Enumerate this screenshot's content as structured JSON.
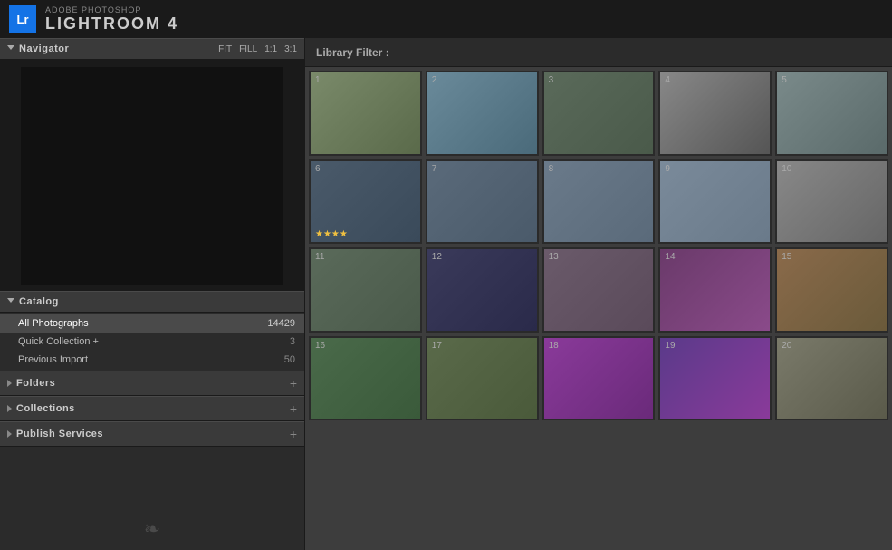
{
  "titlebar": {
    "adobe_label": "ADOBE PHOTOSHOP",
    "app_title": "LIGHTROOM 4",
    "logo_text": "Lr"
  },
  "navigator": {
    "label": "Navigator",
    "zoom_options": [
      "FIT",
      "FILL",
      "1:1",
      "3:1"
    ]
  },
  "catalog": {
    "label": "Catalog",
    "items": [
      {
        "name": "All Photographs",
        "count": "14429",
        "active": true
      },
      {
        "name": "Quick Collection +",
        "count": "3",
        "active": false
      },
      {
        "name": "Previous Import",
        "count": "50",
        "active": false
      }
    ]
  },
  "folders": {
    "label": "Folders",
    "add_icon": "+"
  },
  "collections": {
    "label": "Collections",
    "add_icon": "+"
  },
  "publish_services": {
    "label": "Publish Services",
    "add_icon": "+"
  },
  "filter_bar": {
    "label": "Library Filter :"
  },
  "grid": {
    "rows": [
      {
        "photos": [
          {
            "num": "1",
            "style": "photo-1",
            "stars": ""
          },
          {
            "num": "2",
            "style": "photo-2",
            "stars": ""
          },
          {
            "num": "3",
            "style": "photo-3",
            "stars": ""
          },
          {
            "num": "4",
            "style": "photo-4",
            "stars": ""
          },
          {
            "num": "5",
            "style": "photo-5",
            "stars": ""
          }
        ]
      },
      {
        "photos": [
          {
            "num": "6",
            "style": "photo-6",
            "stars": "★★★★"
          },
          {
            "num": "7",
            "style": "photo-7",
            "stars": ""
          },
          {
            "num": "8",
            "style": "photo-8",
            "stars": ""
          },
          {
            "num": "9",
            "style": "photo-9",
            "stars": ""
          },
          {
            "num": "10",
            "style": "photo-10",
            "stars": ""
          }
        ]
      },
      {
        "photos": [
          {
            "num": "11",
            "style": "photo-11",
            "stars": ""
          },
          {
            "num": "12",
            "style": "photo-12",
            "stars": ""
          },
          {
            "num": "13",
            "style": "photo-13",
            "stars": ""
          },
          {
            "num": "14",
            "style": "photo-14",
            "stars": ""
          },
          {
            "num": "15",
            "style": "photo-15",
            "stars": ""
          }
        ]
      },
      {
        "photos": [
          {
            "num": "16",
            "style": "photo-16",
            "stars": ""
          },
          {
            "num": "17",
            "style": "photo-17",
            "stars": ""
          },
          {
            "num": "18",
            "style": "photo-18",
            "stars": ""
          },
          {
            "num": "19",
            "style": "photo-19",
            "stars": ""
          },
          {
            "num": "20",
            "style": "photo-20",
            "stars": ""
          }
        ]
      }
    ]
  },
  "decorative_icon": "❧"
}
